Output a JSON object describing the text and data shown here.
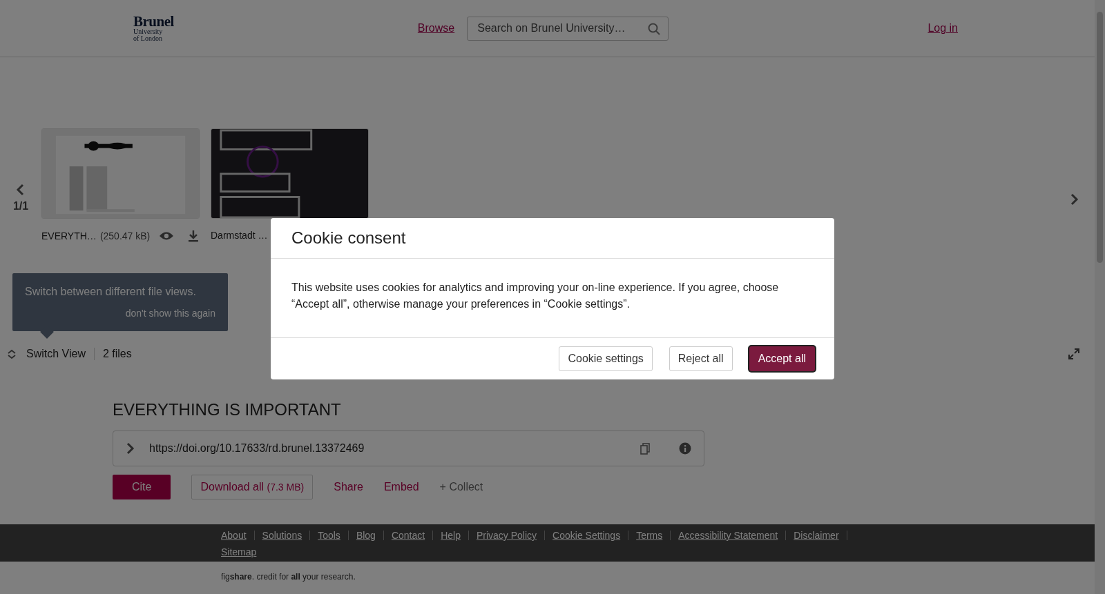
{
  "header": {
    "logo": {
      "name": "Brunel",
      "lines": [
        "University",
        "of London"
      ]
    },
    "nav_link": "Browse",
    "search": {
      "placeholder": "Search on Brunel University…"
    },
    "login": "Log in"
  },
  "carousel": {
    "page": "1/1",
    "files": [
      {
        "name": "EVERYTH…",
        "size": "(250.47 kB)"
      },
      {
        "name": "Darmstadt …"
      }
    ]
  },
  "tooltip": {
    "text": "Switch between different file views.",
    "dismiss": "don't show this again"
  },
  "toolbar": {
    "switch_view": "Switch View",
    "count": "2 files"
  },
  "item": {
    "title": "EVERYTHING IS IMPORTANT",
    "doi": "https://doi.org/10.17633/rd.brunel.13372469",
    "actions": [
      {
        "kind": "primary",
        "label": "Cite"
      },
      {
        "kind": "outline",
        "label": "Download all",
        "note": "(7.3 MB)"
      },
      {
        "kind": "link",
        "label": "Share"
      },
      {
        "kind": "link",
        "label": "Embed"
      },
      {
        "kind": "muted",
        "label": "+ Collect"
      }
    ]
  },
  "footer": {
    "links": [
      "About",
      "Solutions",
      "Tools",
      "Blog",
      "Contact",
      "Help",
      "Privacy Policy",
      "Cookie Settings",
      "Terms",
      "Accessibility Statement",
      "Disclaimer",
      "Sitemap"
    ],
    "tagline": "fig**share**. credit for **all** your research."
  },
  "cookie_dialog": {
    "title": "Cookie consent",
    "body": "This website uses cookies for analytics and improving your on-line experience. If you agree, choose “Accept all”, otherwise manage your preferences in “Cookie settings”.",
    "buttons": [
      {
        "kind": "secondary",
        "label": "Cookie settings",
        "focused": false
      },
      {
        "kind": "secondary",
        "label": "Reject all",
        "focused": false
      },
      {
        "kind": "primary",
        "label": "Accept all",
        "focused": true
      }
    ]
  }
}
